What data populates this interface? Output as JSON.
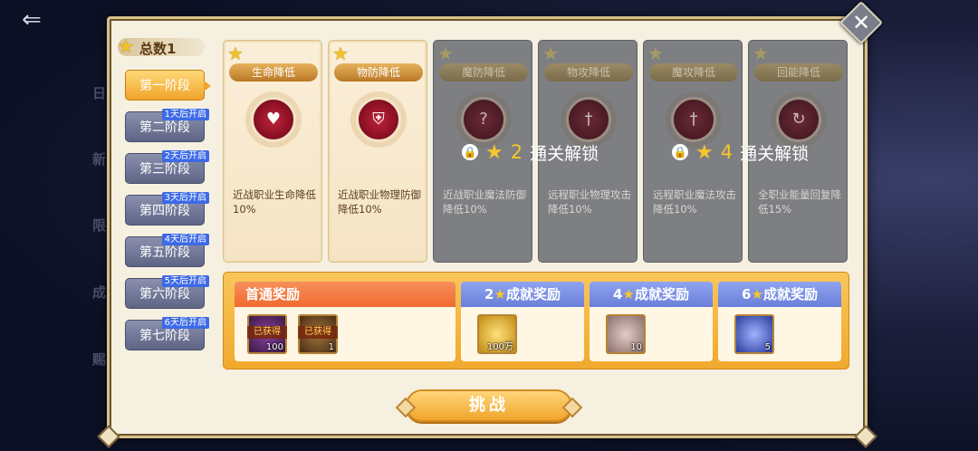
{
  "background": {
    "left_texts": [
      "日",
      "新",
      "限",
      "成",
      "赐"
    ]
  },
  "total": {
    "label": "总数1"
  },
  "stages": [
    {
      "label": "第一阶段",
      "badge": "",
      "active": true
    },
    {
      "label": "第二阶段",
      "badge": "1天后开启",
      "active": false
    },
    {
      "label": "第三阶段",
      "badge": "2天后开启",
      "active": false
    },
    {
      "label": "第四阶段",
      "badge": "3天后开启",
      "active": false
    },
    {
      "label": "第五阶段",
      "badge": "4天后开启",
      "active": false
    },
    {
      "label": "第六阶段",
      "badge": "5天后开启",
      "active": false
    },
    {
      "label": "第七阶段",
      "badge": "6天后开启",
      "active": false
    }
  ],
  "cards": [
    {
      "title": "生命降低",
      "desc": "近战职业生命降低10%",
      "locked": false,
      "icon": "heart-shield-icon"
    },
    {
      "title": "物防降低",
      "desc": "近战职业物理防御降低10%",
      "locked": false,
      "icon": "shield-icon"
    },
    {
      "title": "魔防降低",
      "desc": "近战职业魔法防御降低10%",
      "locked": true,
      "icon": "magic-shield-icon"
    },
    {
      "title": "物攻降低",
      "desc": "远程职业物理攻击降低10%",
      "locked": true,
      "icon": "sword-icon"
    },
    {
      "title": "魔攻降低",
      "desc": "远程职业魔法攻击降低10%",
      "locked": true,
      "icon": "magic-sword-icon"
    },
    {
      "title": "回能降低",
      "desc": "全职业能量回复降低15%",
      "locked": true,
      "icon": "energy-icon"
    }
  ],
  "unlocks": [
    {
      "count": "2",
      "text": "通关解锁"
    },
    {
      "count": "4",
      "text": "通关解锁"
    }
  ],
  "rewards": {
    "first_clear": {
      "title": "首通奖励",
      "items": [
        {
          "name": "fruit-item",
          "claimed_label": "已获得",
          "qty": "100",
          "color": "#5a2a5e"
        },
        {
          "name": "chest-item",
          "claimed_label": "已获得",
          "qty": "1",
          "color": "#6b4a24"
        }
      ]
    },
    "achievements": [
      {
        "count": "2",
        "title": "成就奖励",
        "item": {
          "name": "gold-coin-item",
          "qty": "100万",
          "color": "#d9a628"
        }
      },
      {
        "count": "4",
        "title": "成就奖励",
        "item": {
          "name": "stone-item",
          "qty": "10",
          "color": "#a38a86"
        }
      },
      {
        "count": "6",
        "title": "成就奖励",
        "item": {
          "name": "crystal-item",
          "qty": "5",
          "color": "#3b4fb3"
        }
      }
    ]
  },
  "challenge_label": "挑战",
  "colors": {
    "gold": "#f1a42c",
    "locked_gray": "#7e7f82",
    "stage_blue": "#3d6ae6"
  }
}
